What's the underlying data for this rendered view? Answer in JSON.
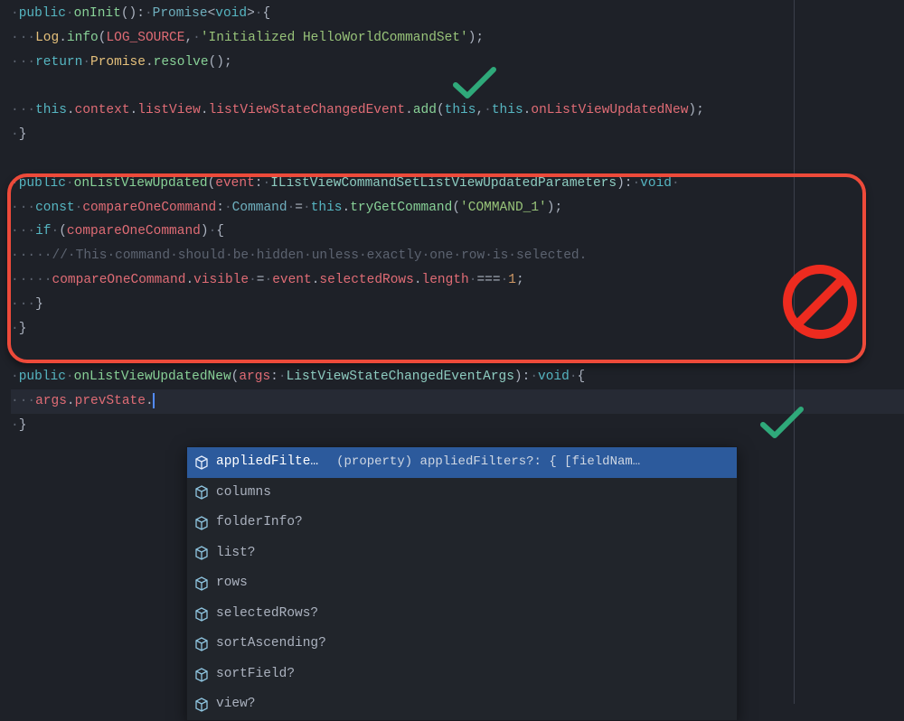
{
  "code": {
    "l1_public": "public",
    "l1_fn": "onInit",
    "l1_type": "Promise",
    "l1_void": "void",
    "l2_cls": "Log",
    "l2_info": "info",
    "l2_src": "LOG_SOURCE",
    "l2_str": "'Initialized HelloWorldCommandSet'",
    "l3_return": "return",
    "l3_cls": "Promise",
    "l3_resolve": "resolve",
    "l5_this1": "this",
    "l5_context": "context",
    "l5_listView": "listView",
    "l5_lvsc": "listViewStateChangedEvent",
    "l5_add": "add",
    "l5_this2": "this",
    "l5_this3": "this",
    "l5_olvun": "onListViewUpdatedNew",
    "l8_public": "public",
    "l8_fn": "onListViewUpdated",
    "l8_param": "event",
    "l8_type": "IListViewCommandSetListViewUpdatedParameters",
    "l8_void": "void",
    "l9_const": "const",
    "l9_var": "compareOneCommand",
    "l9_type": "Command",
    "l9_this": "this",
    "l9_try": "tryGetCommand",
    "l9_str": "'COMMAND_1'",
    "l10_if": "if",
    "l10_var": "compareOneCommand",
    "l11_comment": "// This command should be hidden unless exactly one row is selected.",
    "l12_var": "compareOneCommand",
    "l12_visible": "visible",
    "l12_event": "event",
    "l12_selectedRows": "selectedRows",
    "l12_length": "length",
    "l12_num": "1",
    "l16_public": "public",
    "l16_fn": "onListViewUpdatedNew",
    "l16_param": "args",
    "l16_type": "ListViewStateChangedEventArgs",
    "l16_void": "void",
    "l17_args": "args",
    "l17_prev": "prevState"
  },
  "suggest": {
    "selected_label": "appliedFilte…",
    "selected_hint": "(property) appliedFilters?: { [fieldNam…",
    "items": [
      "columns",
      "folderInfo?",
      "list?",
      "rows",
      "selectedRows?",
      "sortAscending?",
      "sortField?",
      "view?"
    ]
  }
}
